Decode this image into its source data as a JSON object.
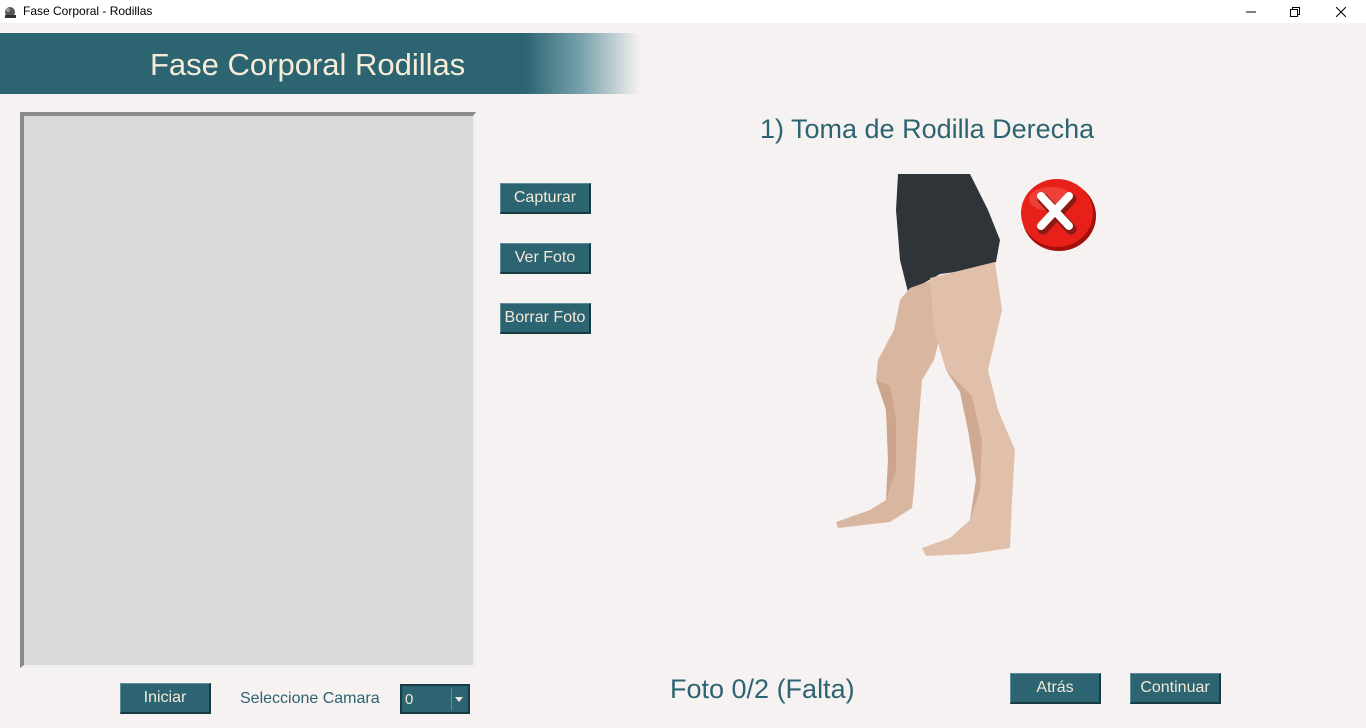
{
  "window": {
    "title": "Fase Corporal - Rodillas",
    "app_icon": "app-icon",
    "controls": [
      "minimize-icon",
      "restore-icon",
      "close-icon"
    ]
  },
  "header": {
    "title": "Fase Corporal Rodillas"
  },
  "actions": {
    "capture_label": "Capturar",
    "view_label": "Ver Foto",
    "delete_label": "Borrar Foto"
  },
  "camera": {
    "start_label": "Iniciar",
    "select_label": "Seleccione Camara",
    "selected_value": "0"
  },
  "step": {
    "title": "1) Toma de Rodilla Derecha",
    "reference_image": "knee-reference-figure",
    "status_icon": "error-x-icon"
  },
  "status": {
    "text": "Foto 0/2 (Falta)"
  },
  "navigation": {
    "back_label": "Atrás",
    "continue_label": "Continuar"
  },
  "colors": {
    "primary": "#2c6472",
    "button_text": "#f3ead8",
    "background": "#f6f2f1",
    "preview_bg": "#d9d9d9",
    "error": "#e8201a"
  }
}
